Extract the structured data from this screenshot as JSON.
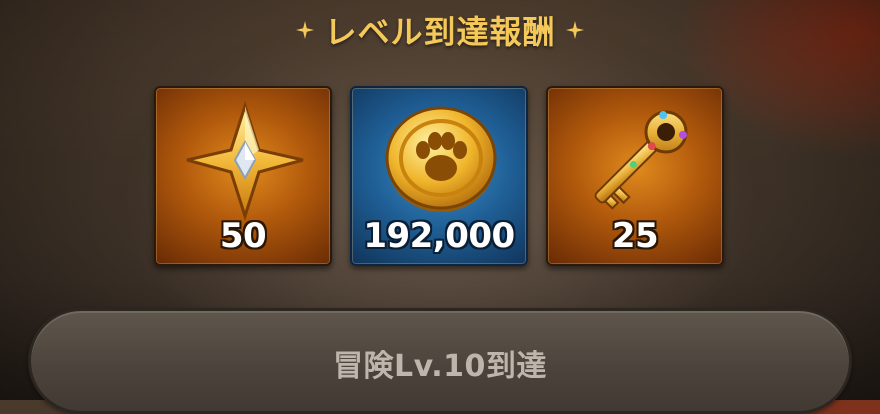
{
  "header": {
    "title": "レベル到達報酬"
  },
  "rewards": [
    {
      "item_icon": "gold-star-crystal-icon",
      "quantity": "50",
      "frame_color": "#c8740f"
    },
    {
      "item_icon": "paw-gold-coin-icon",
      "quantity": "192,000",
      "frame_color": "#2a6fa6"
    },
    {
      "item_icon": "jeweled-golden-key-icon",
      "quantity": "25",
      "frame_color": "#c8740f"
    }
  ],
  "condition": {
    "label": "冒険Lv.10到達"
  },
  "colors": {
    "title": "#f5c85a",
    "button_text": "#bdb6ad"
  }
}
